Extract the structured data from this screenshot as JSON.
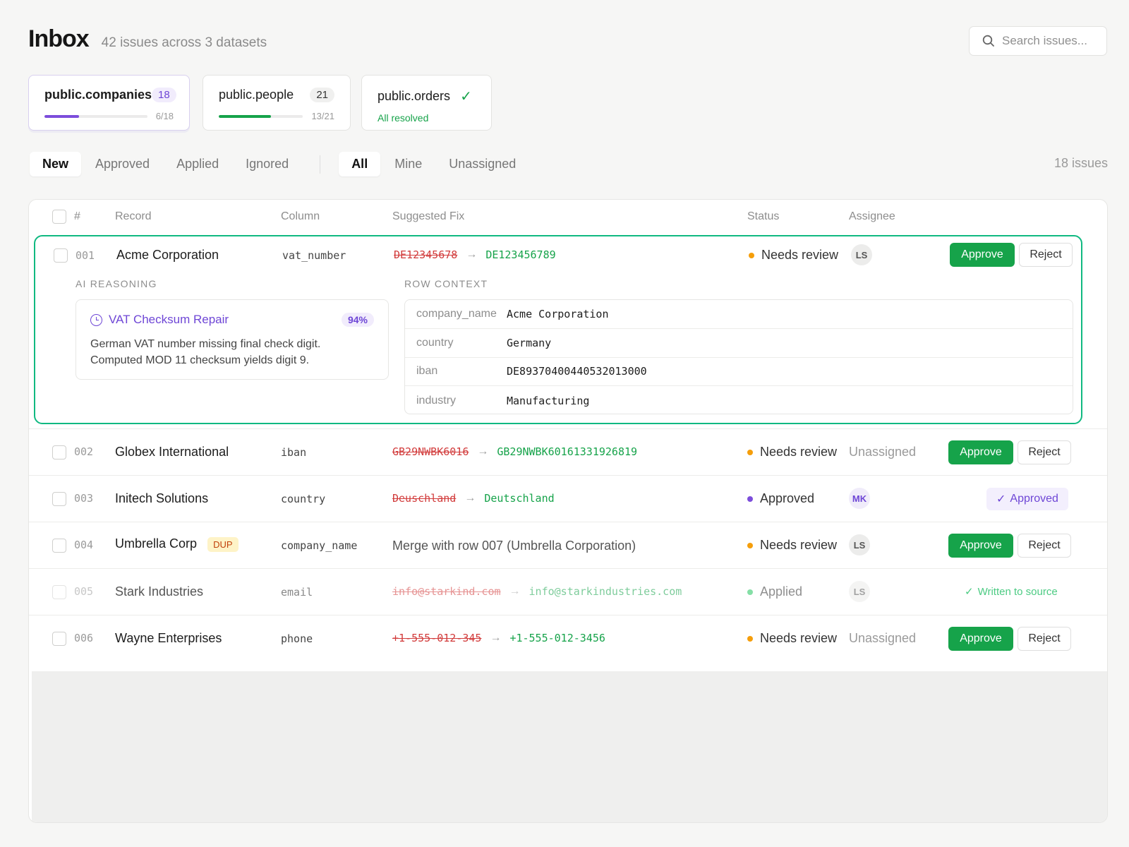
{
  "header": {
    "title": "Inbox",
    "subtitle": "42 issues across 3 datasets",
    "search_placeholder": "Search issues..."
  },
  "datasets": [
    {
      "name": "public.companies",
      "count": "18",
      "progress_label": "6/18",
      "progress": 0.333,
      "bar_color": "#7c4ddb",
      "active": true
    },
    {
      "name": "public.people",
      "count": "21",
      "progress_label": "13/21",
      "progress": 0.619,
      "bar_color": "#16a34a",
      "active": false
    },
    {
      "name": "public.orders",
      "resolved_label": "All resolved",
      "active": false
    }
  ],
  "filters": {
    "stage": [
      "New",
      "Approved",
      "Applied",
      "Ignored"
    ],
    "stage_active": "New",
    "owner": [
      "All",
      "Mine",
      "Unassigned"
    ],
    "owner_active": "All",
    "issue_count": "18 issues"
  },
  "table": {
    "columns": [
      "#",
      "Record",
      "Column",
      "Suggested Fix",
      "Status",
      "Assignee"
    ],
    "rows": [
      {
        "num": "001",
        "record": "Acme Corporation",
        "column": "vat_number",
        "old": "DE12345678",
        "new": "DE123456789",
        "status": "Needs review",
        "status_color": "#f59e0b",
        "assignee": "LS",
        "actions": "approve"
      },
      {
        "num": "002",
        "record": "Globex International",
        "column": "iban",
        "old": "GB29NWBK6016",
        "new": "GB29NWBK60161331926819",
        "status": "Needs review",
        "status_color": "#f59e0b",
        "assignee": "Unassigned",
        "actions": "approve"
      },
      {
        "num": "003",
        "record": "Initech Solutions",
        "column": "country",
        "old": "Deuschland",
        "new": "Deutschland",
        "status": "Approved",
        "status_color": "#7c4ddb",
        "assignee": "MK",
        "actions": "approved",
        "approved_label": "Approved"
      },
      {
        "num": "004",
        "record": "Umbrella Corp",
        "badge": "DUP",
        "column": "company_name",
        "merge": "Merge with row 007 (Umbrella Corporation)",
        "status": "Needs review",
        "status_color": "#f59e0b",
        "assignee": "LS",
        "actions": "approve"
      },
      {
        "num": "005",
        "record": "Stark Industries",
        "column": "email",
        "old": "info@starkind.com",
        "new": "info@starkindustries.com",
        "status": "Applied",
        "status_color": "#22c55e",
        "assignee": "LS",
        "actions": "written",
        "written_label": "Written to source"
      },
      {
        "num": "006",
        "record": "Wayne Enterprises",
        "column": "phone",
        "old": "+1-555-012-345",
        "new": "+1-555-012-3456",
        "status": "Needs review",
        "status_color": "#f59e0b",
        "assignee": "Unassigned",
        "actions": "approve"
      }
    ],
    "approve_label": "Approve",
    "reject_label": "Reject"
  },
  "expanded": {
    "ai_label": "AI REASONING",
    "ai_title": "VAT Checksum Repair",
    "confidence": "94%",
    "ai_body_1": "German VAT number missing final check digit.",
    "ai_body_2": "Computed MOD 11 checksum yields digit 9.",
    "context_label": "ROW CONTEXT",
    "context": [
      {
        "key": "company_name",
        "value": "Acme Corporation"
      },
      {
        "key": "country",
        "value": "Germany"
      },
      {
        "key": "iban",
        "value": "DE89370400440532013000"
      },
      {
        "key": "industry",
        "value": "Manufacturing"
      }
    ]
  },
  "colors": {
    "accent_purple": "#6e46d6",
    "success_green": "#16a34a",
    "highlight_teal": "#10b981",
    "warning_amber": "#f59e0b"
  }
}
